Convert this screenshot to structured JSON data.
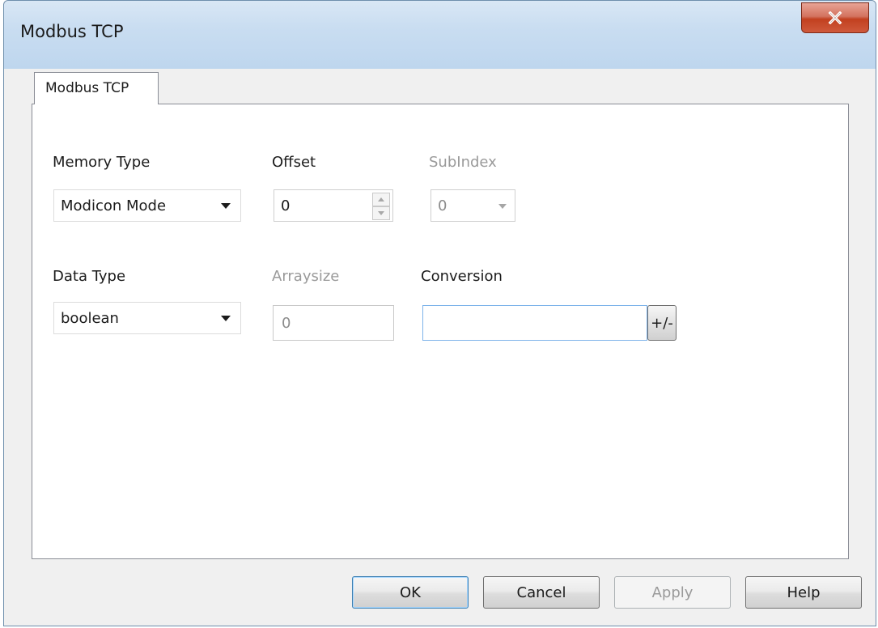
{
  "window": {
    "title": "Modbus TCP"
  },
  "tabs": [
    {
      "label": "Modbus TCP",
      "active": true
    }
  ],
  "form": {
    "memory_type": {
      "label": "Memory Type",
      "value": "Modicon Mode"
    },
    "offset": {
      "label": "Offset",
      "value": "0"
    },
    "subindex": {
      "label": "SubIndex",
      "value": "0",
      "disabled": true
    },
    "data_type": {
      "label": "Data Type",
      "value": "boolean"
    },
    "arraysize": {
      "label": "Arraysize",
      "value": "0",
      "disabled": true
    },
    "conversion": {
      "label": "Conversion",
      "value": "",
      "button_label": "+/-"
    }
  },
  "buttons": {
    "ok": "OK",
    "cancel": "Cancel",
    "apply": "Apply",
    "help": "Help"
  },
  "icons": {
    "close": "close-icon",
    "dropdown": "chevron-down-icon",
    "spin_up": "spin-up-icon",
    "spin_down": "spin-down-icon"
  },
  "colors": {
    "titlebar": "#c9ddf1",
    "close_button": "#c2401f",
    "window_bg": "#f0f0f0",
    "panel_bg": "#ffffff",
    "disabled_text": "#9a9a9a",
    "default_button_border": "#3c7fb1"
  }
}
